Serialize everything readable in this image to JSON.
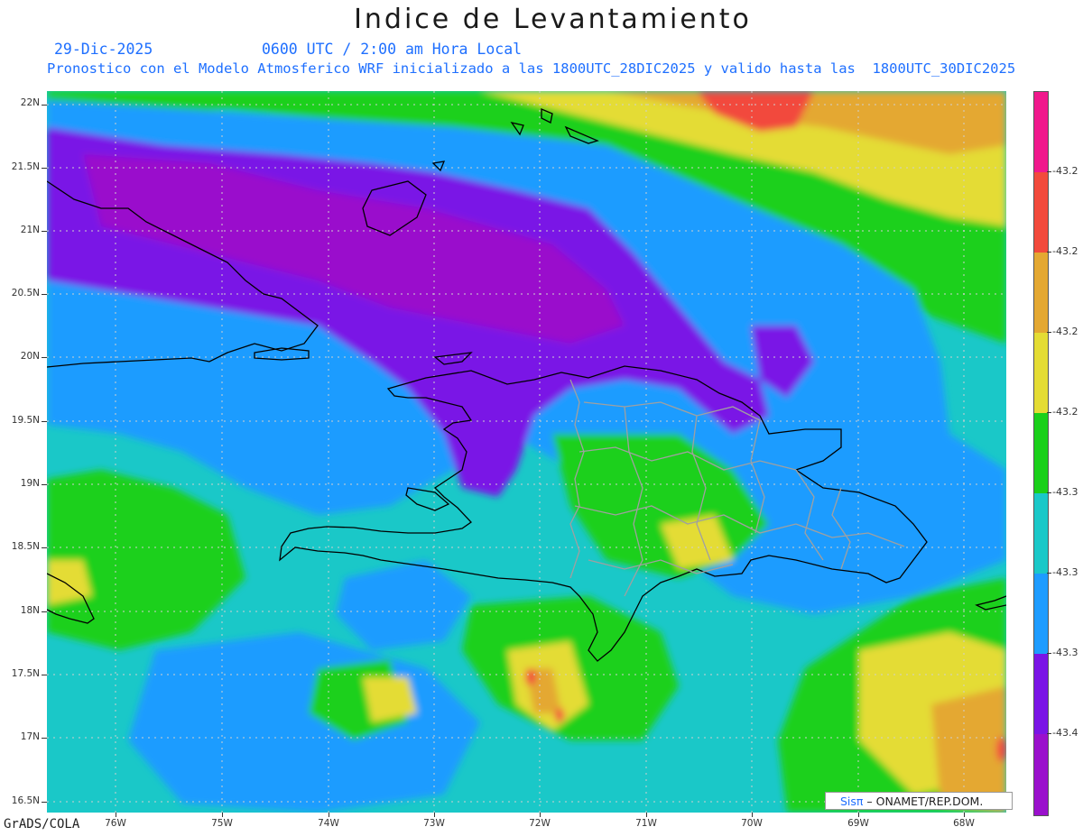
{
  "header": {
    "title": "Indice de Levantamiento",
    "date": "29-Dic-2025",
    "time": "0600 UTC / 2:00 am Hora Local",
    "description": "Pronostico con el Modelo Atmosferico WRF inicializado a las 1800UTC_28DIC2025 y valido hasta las  1800UTC_30DIC2025"
  },
  "axes": {
    "y_labels": [
      "22N",
      "21.5N",
      "21N",
      "20.5N",
      "20N",
      "19.5N",
      "19N",
      "18.5N",
      "18N",
      "17.5N",
      "17N",
      "16.5N"
    ],
    "x_labels": [
      "76W",
      "75W",
      "74W",
      "73W",
      "72W",
      "71W",
      "70W",
      "69W",
      "68W"
    ]
  },
  "colorbar": {
    "labels": [
      "-43.2",
      "-43.2",
      "-43.2",
      "-43.2",
      "-43.3",
      "-43.3",
      "-43.3",
      "-43.4"
    ],
    "colors": [
      "#f0188c",
      "#f24a3c",
      "#e4a832",
      "#e4dc34",
      "#1ad01a",
      "#1ac8c8",
      "#1e9cff",
      "#7a14e6",
      "#9a10cc"
    ]
  },
  "footer": {
    "credit": "GrADS/COLA",
    "signature_brand": "Sisπ",
    "signature_org": " – ONAMET/REP.DOM."
  },
  "map_colors": {
    "ocean_base": "#1ac8c8",
    "lowest": "#9a10cc",
    "low": "#7a14e6",
    "mid_low": "#1e9cff",
    "mid": "#1ad01a",
    "mid_high": "#e4dc34",
    "high": "#e4a832",
    "highest": "#f24a3c",
    "coast": "#000000",
    "borders": "#a0a0a0"
  }
}
